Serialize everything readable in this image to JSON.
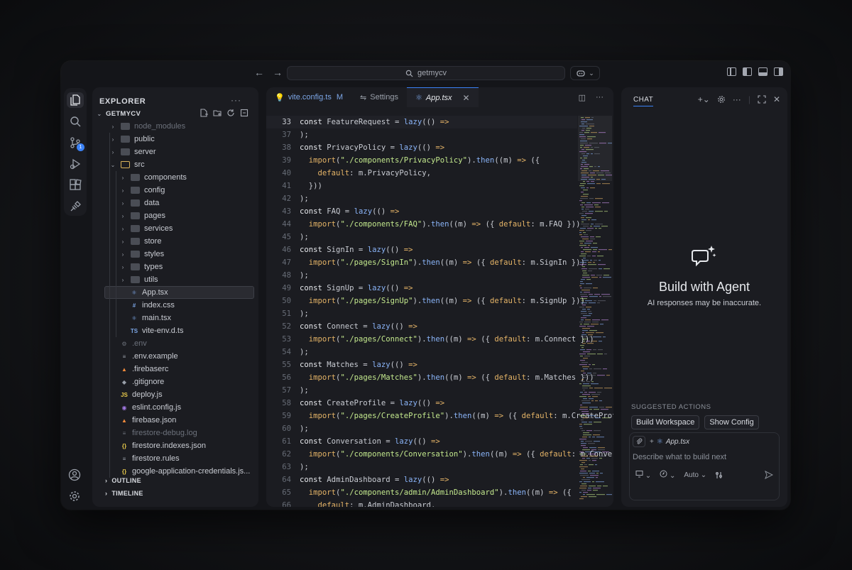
{
  "titlebar": {
    "search_text": "getmycv"
  },
  "explorer": {
    "header": "EXPLORER",
    "project": "GETMYCV",
    "outline": "OUTLINE",
    "timeline": "TIMELINE",
    "rows": [
      {
        "label": "node_modules",
        "kind": "folder",
        "depth": 1,
        "dim": true
      },
      {
        "label": "public",
        "kind": "folder",
        "depth": 1
      },
      {
        "label": "server",
        "kind": "folder",
        "depth": 1
      },
      {
        "label": "src",
        "kind": "folder-open",
        "depth": 1
      },
      {
        "label": "components",
        "kind": "folder",
        "depth": 2
      },
      {
        "label": "config",
        "kind": "folder",
        "depth": 2
      },
      {
        "label": "data",
        "kind": "folder",
        "depth": 2
      },
      {
        "label": "pages",
        "kind": "folder",
        "depth": 2
      },
      {
        "label": "services",
        "kind": "folder",
        "depth": 2
      },
      {
        "label": "store",
        "kind": "folder",
        "depth": 2
      },
      {
        "label": "styles",
        "kind": "folder",
        "depth": 2
      },
      {
        "label": "types",
        "kind": "folder",
        "depth": 2
      },
      {
        "label": "utils",
        "kind": "folder",
        "depth": 2
      },
      {
        "label": "App.tsx",
        "kind": "file",
        "icon": "⚛",
        "color": "#7ca6e6",
        "depth": 2,
        "selected": true
      },
      {
        "label": "index.css",
        "kind": "file",
        "icon": "#",
        "color": "#7ca6e6",
        "depth": 2
      },
      {
        "label": "main.tsx",
        "kind": "file",
        "icon": "⚛",
        "color": "#7ca6e6",
        "depth": 2
      },
      {
        "label": "vite-env.d.ts",
        "kind": "file",
        "icon": "TS",
        "color": "#7ca6e6",
        "depth": 2
      },
      {
        "label": ".env",
        "kind": "file",
        "icon": "⚙",
        "color": "#6c717b",
        "depth": 1,
        "dim": true
      },
      {
        "label": ".env.example",
        "kind": "file",
        "icon": "≡",
        "color": "#9aa0aa",
        "depth": 1
      },
      {
        "label": ".firebaserc",
        "kind": "file",
        "icon": "▲",
        "color": "#f28b3c",
        "depth": 1
      },
      {
        "label": ".gitignore",
        "kind": "file",
        "icon": "◆",
        "color": "#9aa0aa",
        "depth": 1
      },
      {
        "label": "deploy.js",
        "kind": "file",
        "icon": "JS",
        "color": "#e6c84b",
        "depth": 1
      },
      {
        "label": "eslint.config.js",
        "kind": "file",
        "icon": "◉",
        "color": "#a47be6",
        "depth": 1
      },
      {
        "label": "firebase.json",
        "kind": "file",
        "icon": "▲",
        "color": "#f28b3c",
        "depth": 1
      },
      {
        "label": "firestore-debug.log",
        "kind": "file",
        "icon": "≡",
        "color": "#6c717b",
        "depth": 1,
        "dim": true
      },
      {
        "label": "firestore.indexes.json",
        "kind": "file",
        "icon": "{}",
        "color": "#e6c84b",
        "depth": 1
      },
      {
        "label": "firestore.rules",
        "kind": "file",
        "icon": "≡",
        "color": "#9aa0aa",
        "depth": 1
      },
      {
        "label": "google-application-credentials.js...",
        "kind": "file",
        "icon": "{}",
        "color": "#e6c84b",
        "depth": 1
      }
    ]
  },
  "editor": {
    "tabs": [
      {
        "label": "vite.config.ts",
        "modifier": "M",
        "icon": "bulb-icon"
      },
      {
        "label": "Settings",
        "icon": "settings-icon"
      },
      {
        "label": "App.tsx",
        "icon": "react-icon",
        "active": true
      }
    ],
    "lines": [
      {
        "n": "33",
        "tokens": [
          [
            "kw",
            "const "
          ],
          [
            "pl",
            "FeatureRequest = "
          ],
          [
            "fn",
            "lazy"
          ],
          [
            "pl",
            "(() "
          ],
          [
            "im",
            "=>"
          ]
        ]
      },
      {
        "n": "37",
        "tokens": [
          [
            "pl",
            ");"
          ]
        ]
      },
      {
        "n": "38",
        "tokens": [
          [
            "kw",
            "const "
          ],
          [
            "pl",
            "PrivacyPolicy = "
          ],
          [
            "fn",
            "lazy"
          ],
          [
            "pl",
            "(() "
          ],
          [
            "im",
            "=>"
          ]
        ]
      },
      {
        "n": "39",
        "tokens": [
          [
            "pl",
            "  "
          ],
          [
            "im",
            "import"
          ],
          [
            "pl",
            "("
          ],
          [
            "str",
            "\"./components/PrivacyPolicy\""
          ],
          [
            "pl",
            ")."
          ],
          [
            "fn",
            "then"
          ],
          [
            "pl",
            "((m) "
          ],
          [
            "im",
            "=>"
          ],
          [
            "pl",
            " ({"
          ]
        ]
      },
      {
        "n": "40",
        "tokens": [
          [
            "pl",
            "    "
          ],
          [
            "im",
            "default"
          ],
          [
            "pl",
            ": m.PrivacyPolicy,"
          ]
        ]
      },
      {
        "n": "41",
        "tokens": [
          [
            "pl",
            "  }))"
          ]
        ]
      },
      {
        "n": "42",
        "tokens": [
          [
            "pl",
            ");"
          ]
        ]
      },
      {
        "n": "43",
        "tokens": [
          [
            "kw",
            "const "
          ],
          [
            "pl",
            "FAQ = "
          ],
          [
            "fn",
            "lazy"
          ],
          [
            "pl",
            "(() "
          ],
          [
            "im",
            "=>"
          ]
        ]
      },
      {
        "n": "44",
        "tokens": [
          [
            "pl",
            "  "
          ],
          [
            "im",
            "import"
          ],
          [
            "pl",
            "("
          ],
          [
            "str",
            "\"./components/FAQ\""
          ],
          [
            "pl",
            ")."
          ],
          [
            "fn",
            "then"
          ],
          [
            "pl",
            "((m) "
          ],
          [
            "im",
            "=>"
          ],
          [
            "pl",
            " ({ "
          ],
          [
            "im",
            "default"
          ],
          [
            "pl",
            ": m.FAQ }))"
          ]
        ]
      },
      {
        "n": "45",
        "tokens": [
          [
            "pl",
            ");"
          ]
        ]
      },
      {
        "n": "46",
        "tokens": [
          [
            "kw",
            "const "
          ],
          [
            "pl",
            "SignIn = "
          ],
          [
            "fn",
            "lazy"
          ],
          [
            "pl",
            "(() "
          ],
          [
            "im",
            "=>"
          ]
        ]
      },
      {
        "n": "47",
        "tokens": [
          [
            "pl",
            "  "
          ],
          [
            "im",
            "import"
          ],
          [
            "pl",
            "("
          ],
          [
            "str",
            "\"./pages/SignIn\""
          ],
          [
            "pl",
            ")."
          ],
          [
            "fn",
            "then"
          ],
          [
            "pl",
            "((m) "
          ],
          [
            "im",
            "=>"
          ],
          [
            "pl",
            " ({ "
          ],
          [
            "im",
            "default"
          ],
          [
            "pl",
            ": m.SignIn }))"
          ]
        ]
      },
      {
        "n": "48",
        "tokens": [
          [
            "pl",
            ");"
          ]
        ]
      },
      {
        "n": "49",
        "tokens": [
          [
            "kw",
            "const "
          ],
          [
            "pl",
            "SignUp = "
          ],
          [
            "fn",
            "lazy"
          ],
          [
            "pl",
            "(() "
          ],
          [
            "im",
            "=>"
          ]
        ]
      },
      {
        "n": "50",
        "tokens": [
          [
            "pl",
            "  "
          ],
          [
            "im",
            "import"
          ],
          [
            "pl",
            "("
          ],
          [
            "str",
            "\"./pages/SignUp\""
          ],
          [
            "pl",
            ")."
          ],
          [
            "fn",
            "then"
          ],
          [
            "pl",
            "((m) "
          ],
          [
            "im",
            "=>"
          ],
          [
            "pl",
            " ({ "
          ],
          [
            "im",
            "default"
          ],
          [
            "pl",
            ": m.SignUp }))"
          ]
        ]
      },
      {
        "n": "51",
        "tokens": [
          [
            "pl",
            ");"
          ]
        ]
      },
      {
        "n": "52",
        "tokens": [
          [
            "kw",
            "const "
          ],
          [
            "pl",
            "Connect = "
          ],
          [
            "fn",
            "lazy"
          ],
          [
            "pl",
            "(() "
          ],
          [
            "im",
            "=>"
          ]
        ]
      },
      {
        "n": "53",
        "tokens": [
          [
            "pl",
            "  "
          ],
          [
            "im",
            "import"
          ],
          [
            "pl",
            "("
          ],
          [
            "str",
            "\"./pages/Connect\""
          ],
          [
            "pl",
            ")."
          ],
          [
            "fn",
            "then"
          ],
          [
            "pl",
            "((m) "
          ],
          [
            "im",
            "=>"
          ],
          [
            "pl",
            " ({ "
          ],
          [
            "im",
            "default"
          ],
          [
            "pl",
            ": m.Connect }))"
          ]
        ]
      },
      {
        "n": "54",
        "tokens": [
          [
            "pl",
            ");"
          ]
        ]
      },
      {
        "n": "55",
        "tokens": [
          [
            "kw",
            "const "
          ],
          [
            "pl",
            "Matches = "
          ],
          [
            "fn",
            "lazy"
          ],
          [
            "pl",
            "(() "
          ],
          [
            "im",
            "=>"
          ]
        ]
      },
      {
        "n": "56",
        "tokens": [
          [
            "pl",
            "  "
          ],
          [
            "im",
            "import"
          ],
          [
            "pl",
            "("
          ],
          [
            "str",
            "\"./pages/Matches\""
          ],
          [
            "pl",
            ")."
          ],
          [
            "fn",
            "then"
          ],
          [
            "pl",
            "((m) "
          ],
          [
            "im",
            "=>"
          ],
          [
            "pl",
            " ({ "
          ],
          [
            "im",
            "default"
          ],
          [
            "pl",
            ": m.Matches }))"
          ]
        ]
      },
      {
        "n": "57",
        "tokens": [
          [
            "pl",
            ");"
          ]
        ]
      },
      {
        "n": "58",
        "tokens": [
          [
            "kw",
            "const "
          ],
          [
            "pl",
            "CreateProfile = "
          ],
          [
            "fn",
            "lazy"
          ],
          [
            "pl",
            "(() "
          ],
          [
            "im",
            "=>"
          ]
        ]
      },
      {
        "n": "59",
        "tokens": [
          [
            "pl",
            "  "
          ],
          [
            "im",
            "import"
          ],
          [
            "pl",
            "("
          ],
          [
            "str",
            "\"./pages/CreateProfile\""
          ],
          [
            "pl",
            ")."
          ],
          [
            "fn",
            "then"
          ],
          [
            "pl",
            "((m) "
          ],
          [
            "im",
            "=>"
          ],
          [
            "pl",
            " ({ "
          ],
          [
            "im",
            "default"
          ],
          [
            "pl",
            ": m.CreateProfile"
          ]
        ]
      },
      {
        "n": "60",
        "tokens": [
          [
            "pl",
            ");"
          ]
        ]
      },
      {
        "n": "61",
        "tokens": [
          [
            "kw",
            "const "
          ],
          [
            "pl",
            "Conversation = "
          ],
          [
            "fn",
            "lazy"
          ],
          [
            "pl",
            "(() "
          ],
          [
            "im",
            "=>"
          ]
        ]
      },
      {
        "n": "62",
        "tokens": [
          [
            "pl",
            "  "
          ],
          [
            "im",
            "import"
          ],
          [
            "pl",
            "("
          ],
          [
            "str",
            "\"./components/Conversation\""
          ],
          [
            "pl",
            ")."
          ],
          [
            "fn",
            "then"
          ],
          [
            "pl",
            "((m) "
          ],
          [
            "im",
            "=>"
          ],
          [
            "pl",
            " ({ "
          ],
          [
            "im",
            "default"
          ],
          [
            "pl",
            ": m.Conversat"
          ]
        ]
      },
      {
        "n": "63",
        "tokens": [
          [
            "pl",
            ");"
          ]
        ]
      },
      {
        "n": "64",
        "tokens": [
          [
            "kw",
            "const "
          ],
          [
            "pl",
            "AdminDashboard = "
          ],
          [
            "fn",
            "lazy"
          ],
          [
            "pl",
            "(() "
          ],
          [
            "im",
            "=>"
          ]
        ]
      },
      {
        "n": "65",
        "tokens": [
          [
            "pl",
            "  "
          ],
          [
            "im",
            "import"
          ],
          [
            "pl",
            "("
          ],
          [
            "str",
            "\"./components/admin/AdminDashboard\""
          ],
          [
            "pl",
            ")."
          ],
          [
            "fn",
            "then"
          ],
          [
            "pl",
            "((m) "
          ],
          [
            "im",
            "=>"
          ],
          [
            "pl",
            " ({"
          ]
        ]
      },
      {
        "n": "66",
        "tokens": [
          [
            "pl",
            "    "
          ],
          [
            "im",
            "default"
          ],
          [
            "pl",
            ": m.AdminDashboard,"
          ]
        ]
      }
    ]
  },
  "chat": {
    "tab": "CHAT",
    "title": "Build with Agent",
    "subtitle": "AI responses may be inaccurate.",
    "suggested_label": "SUGGESTED ACTIONS",
    "suggested": [
      "Build Workspace",
      "Show Config"
    ],
    "context_file": "App.tsx",
    "placeholder": "Describe what to build next",
    "mode": "Auto"
  },
  "colors": {
    "accent": "#3b82f6",
    "background": "#141519",
    "panel": "#1b1c21"
  }
}
